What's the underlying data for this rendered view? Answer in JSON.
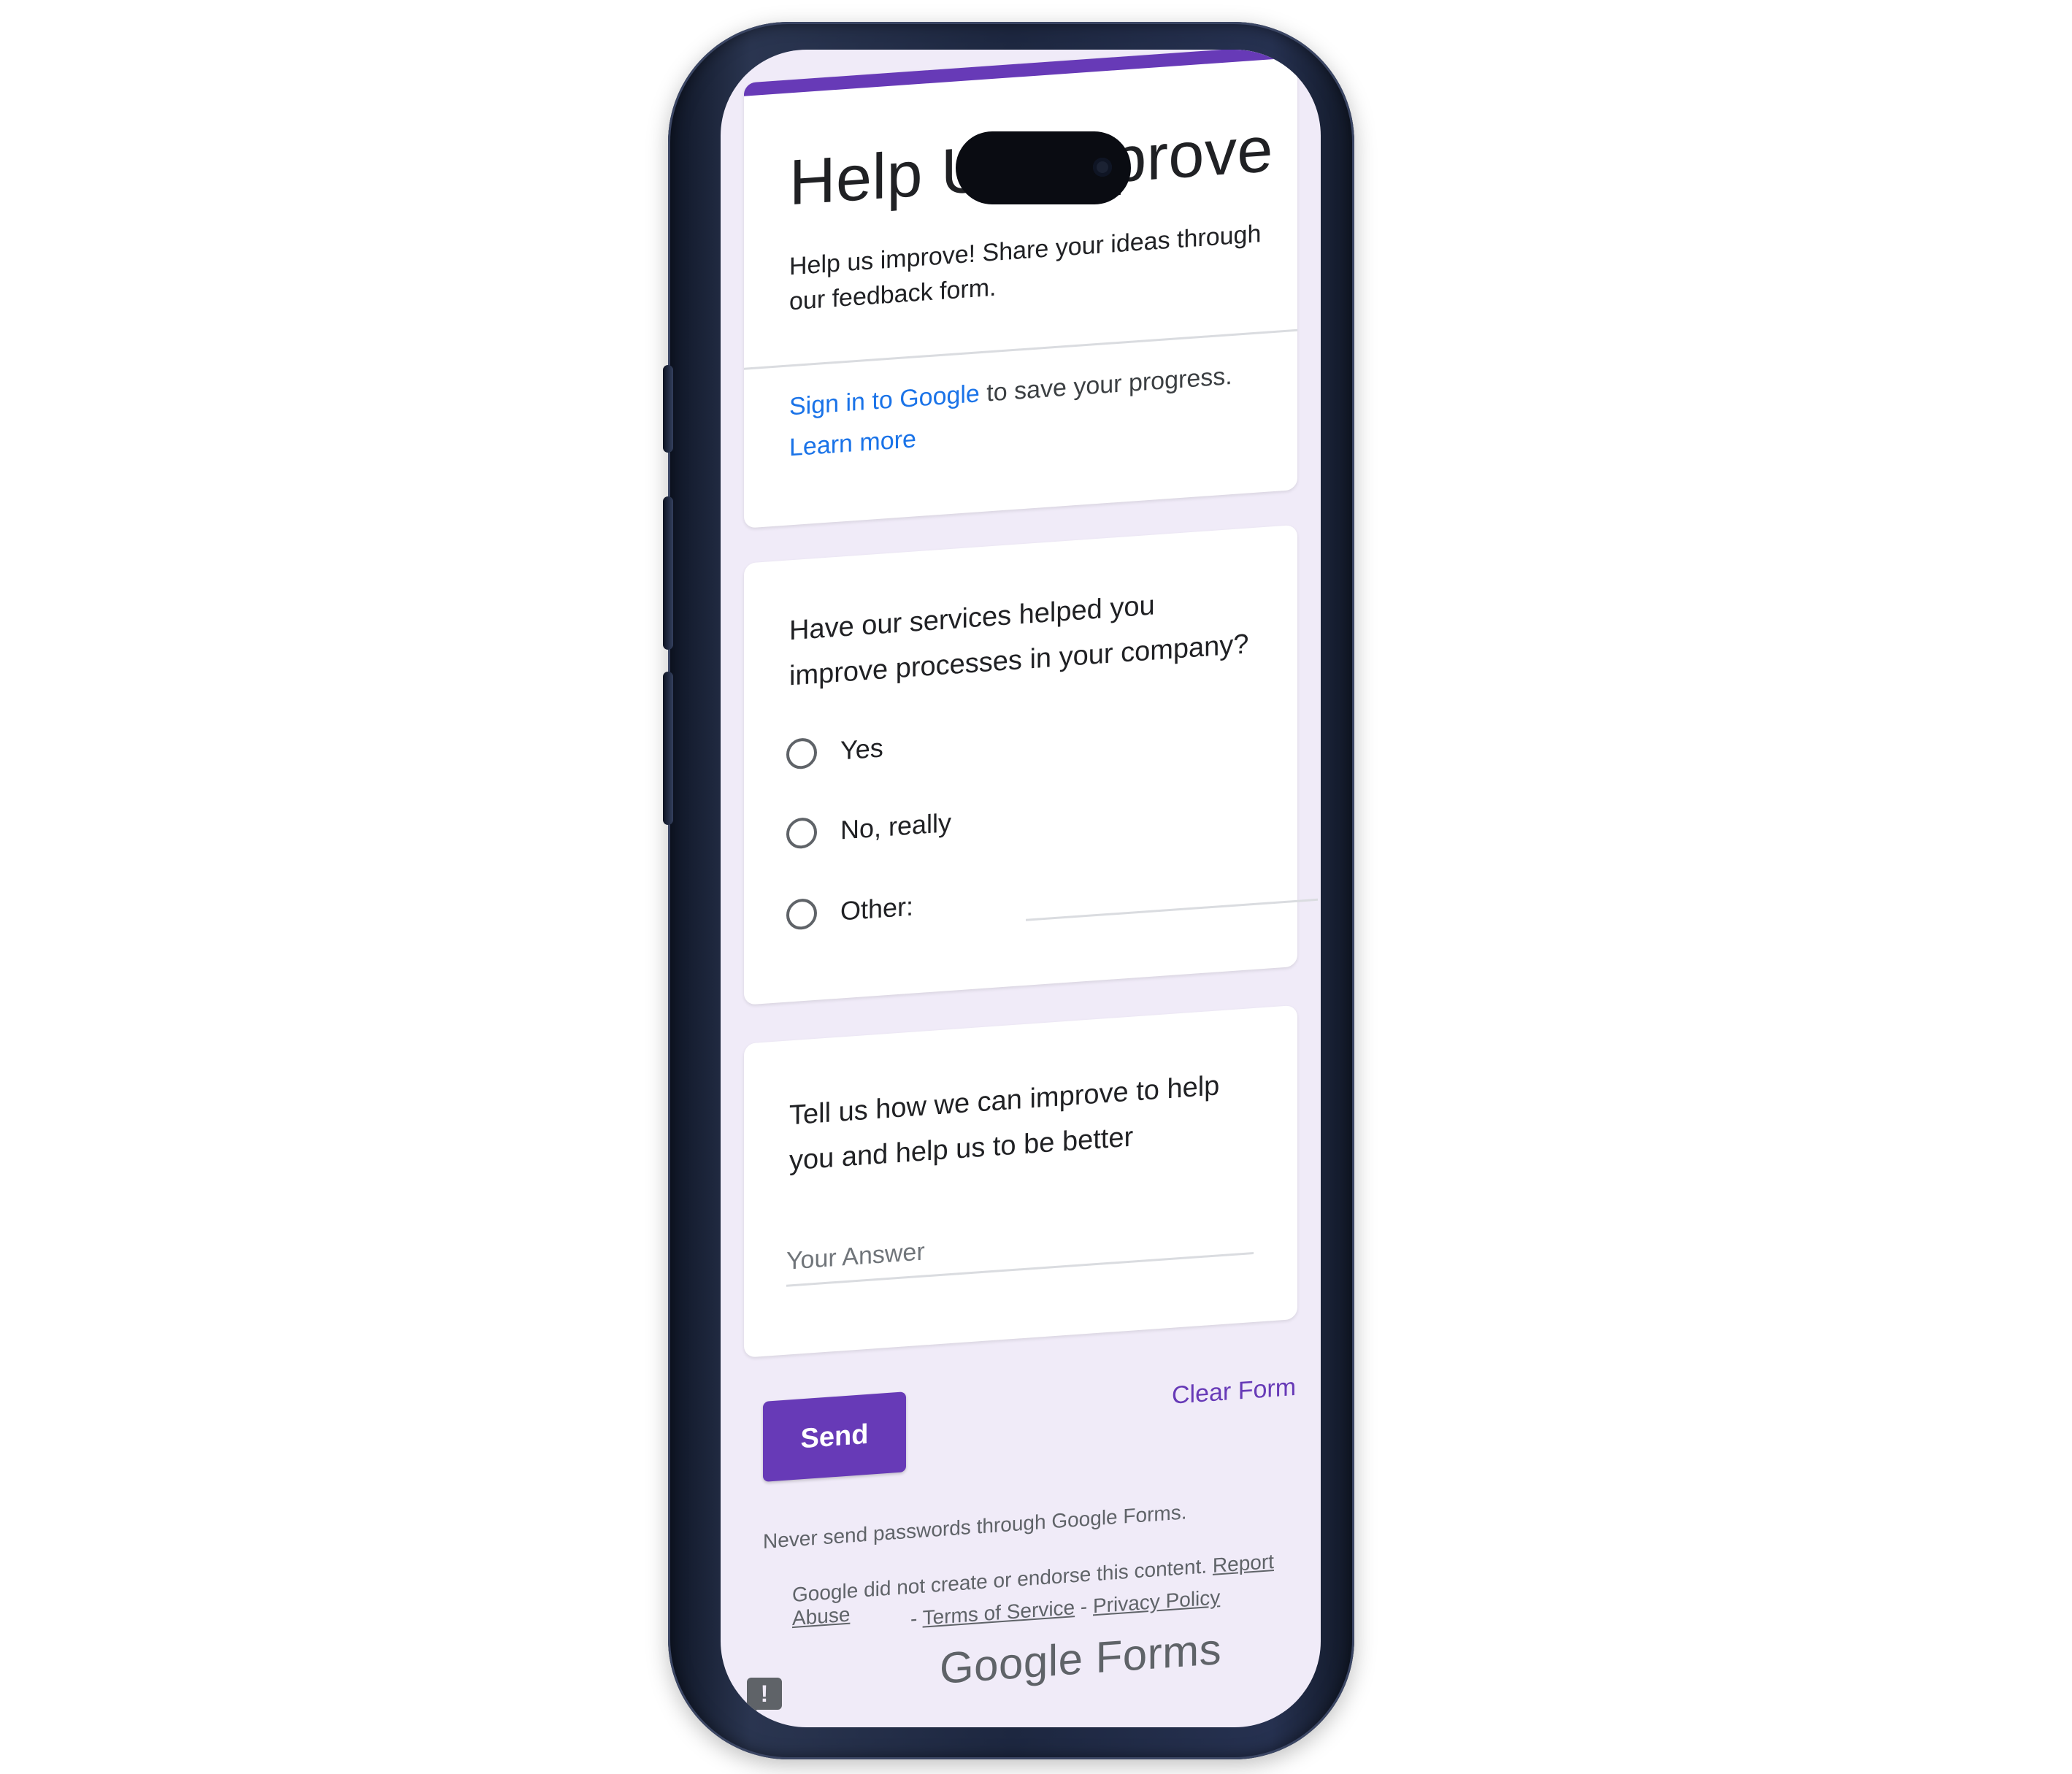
{
  "form": {
    "title": "Help Us Improve",
    "description": "Help us improve! Share your ideas through our feedback form.",
    "signin_link": "Sign in to Google",
    "signin_rest": " to save your progress.",
    "learn_more": "Learn more"
  },
  "question1": {
    "text": "Have our services helped you improve processes in your company?",
    "options": [
      {
        "label": "Yes"
      },
      {
        "label": "No, really"
      },
      {
        "label": "Other:"
      }
    ]
  },
  "question2": {
    "text": "Tell us how we can improve to help you and help us to be better",
    "placeholder": "Your Answer"
  },
  "actions": {
    "send_label": "Send",
    "clear_label": "Clear Form"
  },
  "footer": {
    "password_warning": "Never send passwords through Google Forms.",
    "disclaimer": "Google did not create or endorse this content.",
    "report_abuse": "Report Abuse",
    "dash1": "- ",
    "terms": "Terms of Service",
    "dash2": " - ",
    "privacy": "Privacy Policy",
    "brand": "Google Forms"
  },
  "colors": {
    "accent": "#673ab7",
    "link": "#1a73e8",
    "background": "#f0ebf8"
  },
  "icons": {
    "report": "report-issue-icon",
    "radio": "radio-unchecked-icon"
  }
}
